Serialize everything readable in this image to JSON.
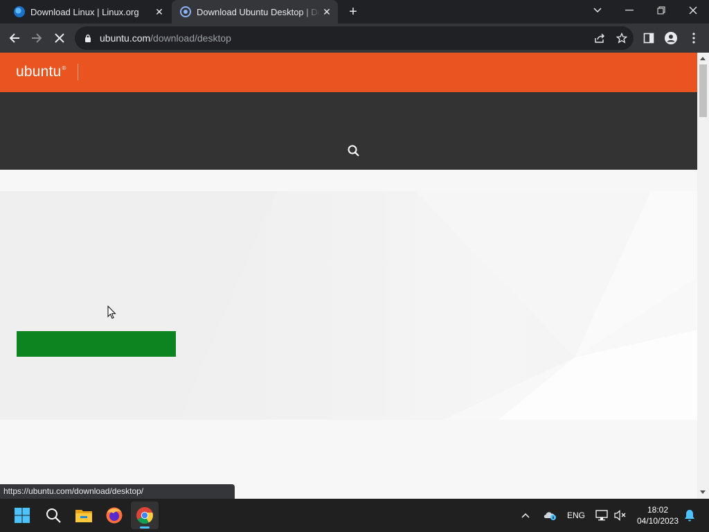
{
  "browser": {
    "tabs": [
      {
        "title": "Download Linux | Linux.org",
        "active": false
      },
      {
        "title": "Download Ubuntu Desktop | Download Ubuntu",
        "active": true
      }
    ],
    "address": {
      "host": "ubuntu.com",
      "path": "/download/desktop"
    },
    "status_url": "https://ubuntu.com/download/desktop/"
  },
  "page": {
    "logo_text": "ubuntu",
    "logo_mark": "®",
    "colors": {
      "header": "#e95420",
      "nav": "#333333",
      "download_button": "#0e8420"
    }
  },
  "taskbar": {
    "apps": [
      "start-icon",
      "search-icon",
      "file-explorer-icon",
      "firefox-icon",
      "chrome-icon"
    ],
    "language": "ENG",
    "time": "18:02",
    "date": "04/10/2023"
  }
}
